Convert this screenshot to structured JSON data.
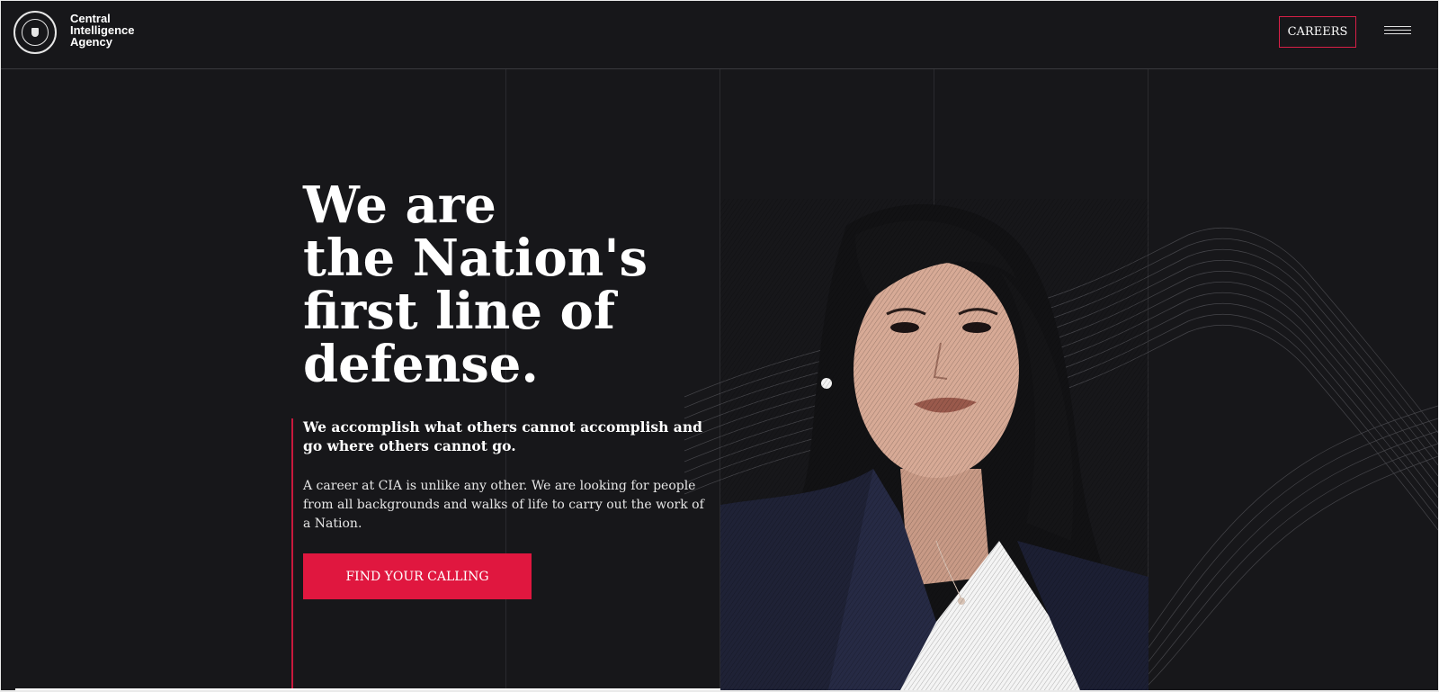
{
  "header": {
    "brand_lines": [
      "Central",
      "Intelligence",
      "Agency"
    ],
    "careers_label": "CAREERS"
  },
  "hero": {
    "headline_lines": [
      "We are",
      "the Nation's",
      "first line of",
      "defense."
    ],
    "subhead": "We accomplish what others cannot accomplish and go where others cannot go.",
    "body": "A career at CIA is unlike any other. We are looking for people from all backgrounds and walks of life to carry out the work of a Nation.",
    "cta_label": "FIND YOUR CALLING"
  },
  "colors": {
    "background": "#17171a",
    "accent_red": "#e0173f",
    "text": "#ffffff"
  },
  "icons": [
    "cia-seal-icon",
    "hamburger-menu-icon"
  ]
}
